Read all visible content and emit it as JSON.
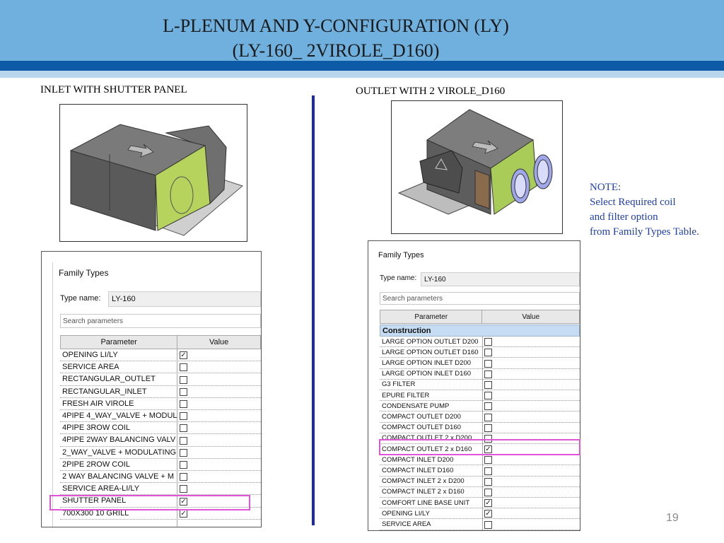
{
  "title": {
    "line1": "L-PLENUM AND Y-CONFIGURATION (LY)",
    "line2": "(LY-160_ 2VIROLE_D160)"
  },
  "left_caption": "INLET WITH SHUTTER PANEL",
  "right_caption": "OUTLET WITH 2 VIROLE_D160",
  "note": {
    "line1": "NOTE:",
    "line2": "Select Required coil",
    "line3": "and filter option",
    "line4": "from Family Types Table."
  },
  "page_number": "19",
  "left_dialog": {
    "title": "Family Types",
    "type_label": "Type name:",
    "type_value": "LY-160",
    "search_placeholder": "Search parameters",
    "col_parameter": "Parameter",
    "col_value": "Value",
    "rows": [
      {
        "name": "OPENING LI/LY",
        "checked": true
      },
      {
        "name": "SERVICE AREA",
        "checked": false
      },
      {
        "name": "RECTANGULAR_OUTLET",
        "checked": false
      },
      {
        "name": "RECTANGULAR_INLET",
        "checked": false
      },
      {
        "name": "FRESH AIR VIROLE",
        "checked": false
      },
      {
        "name": "4PIPE 4_WAY_VALVE + MODUL",
        "checked": false
      },
      {
        "name": "4PIPE 3ROW  COIL",
        "checked": false
      },
      {
        "name": "4PIPE 2WAY BALANCING VALV",
        "checked": false
      },
      {
        "name": "2_WAY_VALVE + MODULATING",
        "checked": false
      },
      {
        "name": "2PIPE 2ROW COIL",
        "checked": false
      },
      {
        "name": "2 WAY BALANCING VALVE + M",
        "checked": false
      },
      {
        "name": "SERVICE AREA-LI/LY",
        "checked": false
      },
      {
        "name": "SHUTTER PANEL",
        "checked": true
      },
      {
        "name": "700X300 10 GRILL",
        "checked": true
      }
    ]
  },
  "right_dialog": {
    "title": "Family Types",
    "type_label": "Type name:",
    "type_value": "LY-160",
    "search_placeholder": "Search parameters",
    "col_parameter": "Parameter",
    "col_value": "Value",
    "section": "Construction",
    "rows": [
      {
        "name": "LARGE OPTION OUTLET D200",
        "checked": false
      },
      {
        "name": "LARGE OPTION OUTLET D160",
        "checked": false
      },
      {
        "name": "LARGE OPTION INLET D200",
        "checked": false
      },
      {
        "name": "LARGE OPTION INLET D160",
        "checked": false
      },
      {
        "name": "G3 FILTER",
        "checked": false
      },
      {
        "name": "EPURE FILTER",
        "checked": false
      },
      {
        "name": "CONDENSATE PUMP",
        "checked": false
      },
      {
        "name": "COMPACT OUTLET D200",
        "checked": false
      },
      {
        "name": "COMPACT OUTLET D160",
        "checked": false
      },
      {
        "name": "COMPACT OUTLET 2 x D200",
        "checked": false
      },
      {
        "name": "COMPACT OUTLET 2 x D160",
        "checked": true
      },
      {
        "name": "COMPACT INLET D200",
        "checked": false
      },
      {
        "name": "COMPACT INLET D160",
        "checked": false
      },
      {
        "name": "COMPACT INLET 2 x D200",
        "checked": false
      },
      {
        "name": "COMPACT INLET 2 x D160",
        "checked": false
      },
      {
        "name": "COMFORT LINE BASE UNIT",
        "checked": true
      },
      {
        "name": "OPENING LI/LY",
        "checked": true
      },
      {
        "name": "SERVICE AREA",
        "checked": false
      }
    ]
  },
  "colors": {
    "header": "#6fb0de",
    "stripe": "#0d5aa7",
    "note_text": "#1f3fae",
    "highlight": "#e055d8",
    "divider": "#1d28b8"
  }
}
